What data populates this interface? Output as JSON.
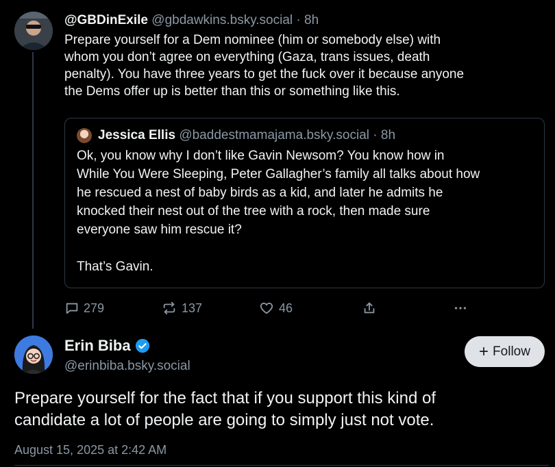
{
  "parent_post": {
    "author_name": "@GBDinExile",
    "handle": "@gbdawkins.bsky.social",
    "time": "8h",
    "text": "Prepare yourself for a Dem nominee (him or somebody else) with\nwhom you don’t agree on everything (Gaza, trans issues, death\npenalty). You have three years to get the fuck over it because anyone\nthe Dems offer up is better than this or something like this."
  },
  "quoted_post": {
    "author_name": "Jessica Ellis",
    "handle": "@baddestmamajama.bsky.social",
    "time": "8h",
    "text": "Ok, you know why I don’t like Gavin Newsom? You know how in\nWhile You Were Sleeping, Peter Gallagher’s family all talks about how\nhe rescued a nest of baby birds as a kid, and later he admits he\nknocked their nest out of the tree with a rock, then made sure\neveryone saw him rescue it?\n\nThat’s Gavin."
  },
  "actions": {
    "reply_count": "279",
    "repost_count": "137",
    "like_count": "46"
  },
  "main_post": {
    "author_name": "Erin Biba",
    "handle": "@erinbiba.bsky.social",
    "follow_label": "Follow",
    "text": "Prepare yourself for the fact that if you support this kind of\ncandidate a lot of people are going to simply just not vote.",
    "timestamp": "August 15, 2025 at 2:42 AM"
  },
  "icons": [
    "reply-icon",
    "repost-icon",
    "like-icon",
    "share-icon",
    "more-icon",
    "verified-badge-icon"
  ],
  "colors": {
    "background": "#000000",
    "text": "#f1f3f5",
    "muted": "#8b98a5",
    "verified": "#1d9bf0",
    "follow_bg": "#dfe3e8"
  }
}
